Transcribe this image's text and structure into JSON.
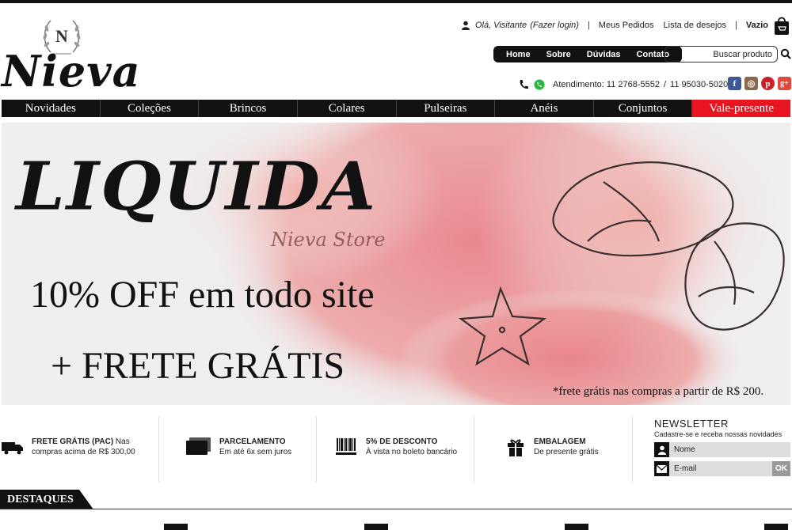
{
  "brand": {
    "name": "Nieva",
    "emblem_letter": "N"
  },
  "user_bar": {
    "greeting": "Olá, Visitante",
    "login": "(Fazer login)",
    "orders": "Meus Pedidos",
    "wishlist": "Lista de desejos",
    "cart": "Vazio",
    "separator": "|"
  },
  "top_nav": [
    "Home",
    "Sobre",
    "Dúvidas",
    "Contato"
  ],
  "search": {
    "placeholder": "Buscar produto"
  },
  "contact": {
    "label": "Atendimento: 11 2768-5552",
    "slash": "/",
    "phone2": "11 95030-5020"
  },
  "socials": [
    {
      "icon": "facebook-icon",
      "glyph": "f",
      "color": "#3b5998"
    },
    {
      "icon": "instagram-icon",
      "glyph": "◎",
      "color": "#8a6a4f"
    },
    {
      "icon": "pinterest-icon",
      "glyph": "p",
      "color": "#cb2027"
    },
    {
      "icon": "google-plus-icon",
      "glyph": "g+",
      "color": "#dd4b39"
    }
  ],
  "main_nav": [
    "Novidades",
    "Coleções",
    "Brincos",
    "Colares",
    "Pulseiras",
    "Anéis",
    "Conjuntos",
    "Vale-presente"
  ],
  "banner": {
    "title": "LIQUIDA",
    "store": "Nieva Store",
    "offer": "10% OFF em todo site",
    "frete": "+ FRETE GRÁTIS",
    "note": "*frete grátis nas compras a partir de R$ 200."
  },
  "features": [
    {
      "icon": "truck-icon",
      "title": "FRETE GRÁTIS (PAC)",
      "title_tail": " Nas",
      "text": "compras acima de R$ 300,00"
    },
    {
      "icon": "credit-card-icon",
      "title": "PARCELAMENTO",
      "text": "Em até 6x sem juros"
    },
    {
      "icon": "barcode-icon",
      "title": "5% DE DESCONTO",
      "text": "À vista no boleto bancário"
    },
    {
      "icon": "gift-icon",
      "title": "EMBALAGEM",
      "text": "De presente grátis"
    }
  ],
  "newsletter": {
    "title": "NEWSLETTER",
    "subtitle": "Cadastre-se e receba nossas novidades",
    "name_placeholder": "Nome",
    "email_placeholder": "E-mail",
    "ok": "OK"
  },
  "destaques": {
    "title": "DESTAQUES"
  },
  "colors": {
    "accent": "#e8141f",
    "dark": "#111111",
    "banner_wash": "#e58e8e"
  }
}
